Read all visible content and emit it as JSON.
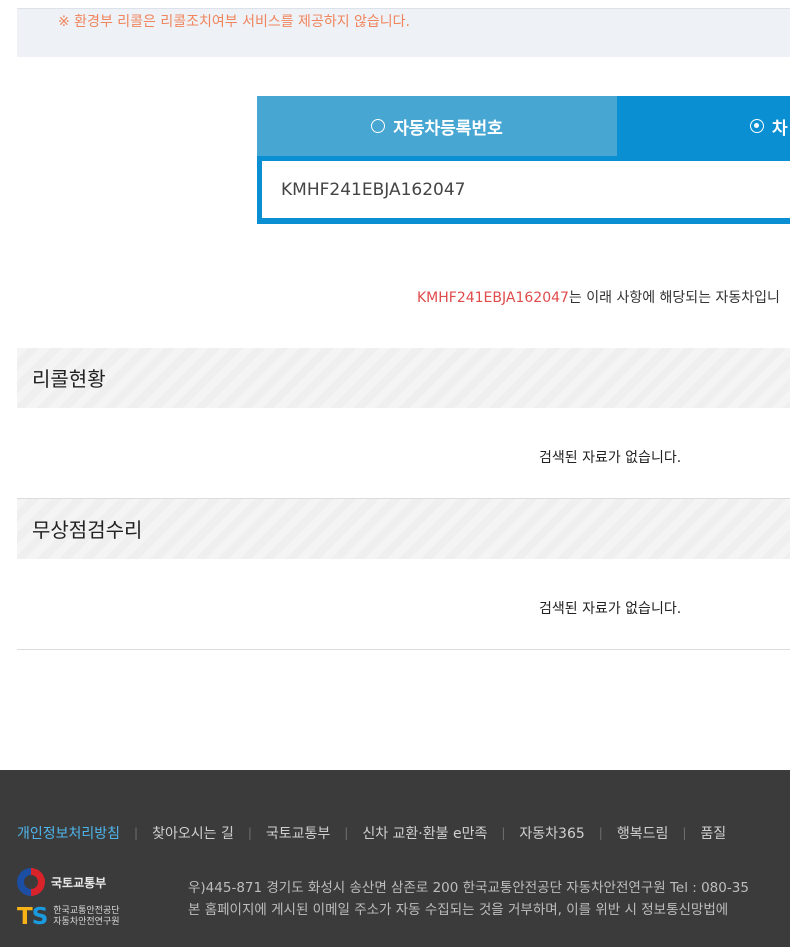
{
  "notice": {
    "text": "※ 환경부 리콜은 리콜조치여부 서비스를 제공하지 않습니다."
  },
  "search": {
    "tab_regno_label": "자동차등록번호",
    "tab_vin_label": "차",
    "selected_tab": "vin",
    "input_value": "KMHF241EBJA162047"
  },
  "result": {
    "vin": "KMHF241EBJA162047",
    "message": "는 이래 사항에 해당되는 자동차입니"
  },
  "sections": {
    "recall": {
      "title": "리콜현황",
      "empty_text": "검색된 자료가 없습니다."
    },
    "free_repair": {
      "title": "무상점검수리",
      "empty_text": "검색된 자료가 없습니다."
    }
  },
  "footer": {
    "nav": [
      "개인정보처리방침",
      "찾아오시는 길",
      "국토교통부",
      "신차 교환·환불 e만족",
      "자동차365",
      "행복드림",
      "품질"
    ],
    "molit_logo_text": "국토교통부",
    "ts_logo_line1": "한국교통안전공단",
    "ts_logo_line2": "자동차안전연구원",
    "address_line1": "우)445-871 경기도 화성시 송산면 삼존로 200 한국교통안전공단 자동차안전연구원 Tel : 080-35",
    "address_line2": "본 홈페이지에 게시된 이메일 주소가 자동 수집되는 것을 거부하며, 이를 위반 시 정보통신망법에"
  },
  "colors": {
    "notice_orange": "#f0855d",
    "tab_light_blue": "#47a6d2",
    "tab_active_blue": "#0b8fd3",
    "vin_highlight_red": "#e04b4b",
    "footer_bg": "#3b3b3b",
    "footer_link_blue": "#4fb4ea"
  }
}
